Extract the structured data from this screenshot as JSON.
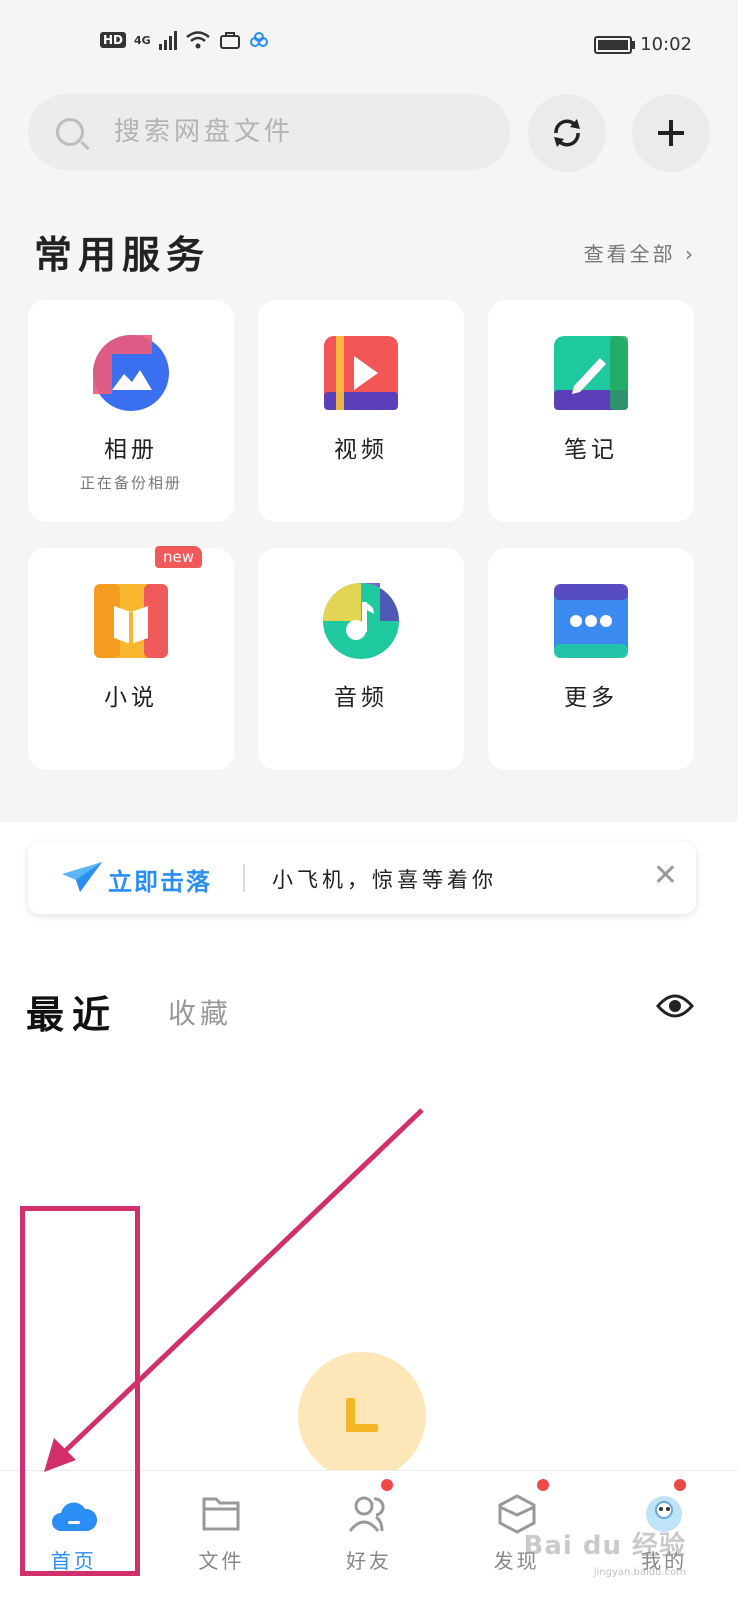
{
  "status_bar": {
    "hd": "HD",
    "network": "4G",
    "time": "10:02"
  },
  "search": {
    "placeholder": "搜索网盘文件"
  },
  "services": {
    "title": "常用服务",
    "see_all": "查看全部 ›",
    "items": [
      {
        "label": "相册",
        "sub": "正在备份相册",
        "icon": "photo-album-icon"
      },
      {
        "label": "视频",
        "icon": "video-play-icon"
      },
      {
        "label": "笔记",
        "icon": "note-pencil-icon"
      },
      {
        "label": "小说",
        "badge": "new",
        "icon": "book-icon"
      },
      {
        "label": "音频",
        "icon": "music-note-icon"
      },
      {
        "label": "更多",
        "icon": "more-dots-icon"
      }
    ]
  },
  "promo": {
    "cta": "立即击落",
    "message": "小飞机，惊喜等着你"
  },
  "recent": {
    "tab_recent": "最近",
    "tab_favorites": "收藏"
  },
  "bottom_nav": {
    "items": [
      {
        "label": "首页",
        "icon": "home-cloud-icon",
        "active": true
      },
      {
        "label": "文件",
        "icon": "folder-icon"
      },
      {
        "label": "好友",
        "icon": "friends-icon"
      },
      {
        "label": "发现",
        "icon": "discover-cube-icon"
      },
      {
        "label": "我的",
        "icon": "profile-avatar-icon"
      }
    ]
  },
  "watermark": {
    "text": "Bai du 经验",
    "sub": "jingyan.baidu.com"
  },
  "colors": {
    "accent": "#2b8ef5",
    "annotation": "#d1306d",
    "badge_red": "#f05a5a"
  }
}
